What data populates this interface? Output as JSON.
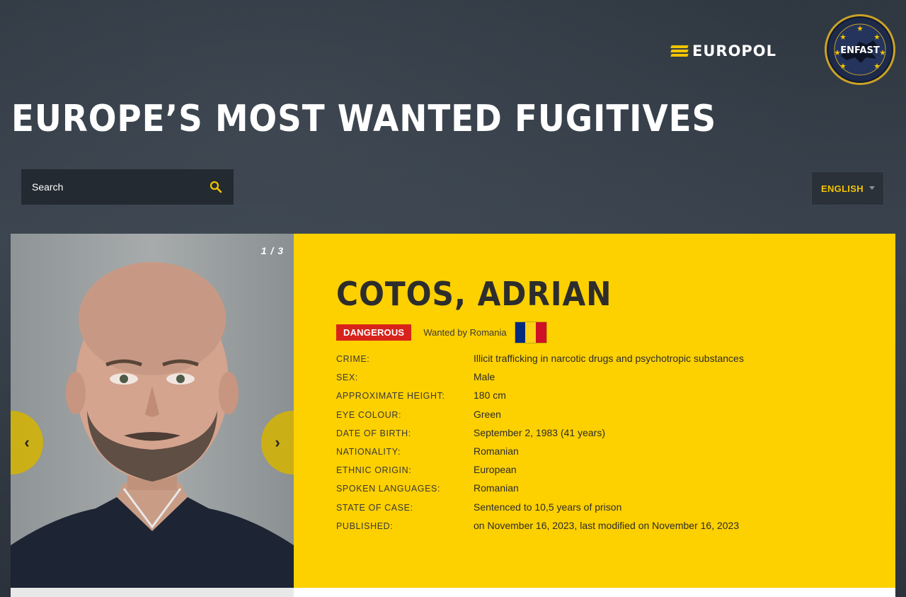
{
  "header": {
    "europol_logo_text": "EUROPOL",
    "enfast_badge_text": "ENFAST",
    "title": "EUROPE’S MOST WANTED FUGITIVES"
  },
  "search": {
    "placeholder": "Search"
  },
  "language": {
    "selected": "ENGLISH"
  },
  "gallery": {
    "counter": "1 / 3",
    "prev_label": "‹",
    "next_label": "›"
  },
  "fugitive": {
    "name": "COTOS, ADRIAN",
    "danger_label": "DANGEROUS",
    "wanted_by": "Wanted by Romania",
    "flag_colors": [
      "#002B7F",
      "#FCD116",
      "#CE1126"
    ],
    "details": [
      {
        "label": "CRIME:",
        "value": "Illicit trafficking in narcotic drugs and psychotropic substances"
      },
      {
        "label": "SEX:",
        "value": "Male"
      },
      {
        "label": "APPROXIMATE HEIGHT:",
        "value": "180 cm"
      },
      {
        "label": "EYE COLOUR:",
        "value": "Green"
      },
      {
        "label": "DATE OF BIRTH:",
        "value": "September 2, 1983 (41 years)"
      },
      {
        "label": "NATIONALITY:",
        "value": "Romanian"
      },
      {
        "label": "ETHNIC ORIGIN:",
        "value": "European"
      },
      {
        "label": "SPOKEN LANGUAGES:",
        "value": "Romanian"
      },
      {
        "label": "STATE OF CASE:",
        "value": "Sentenced to 10,5 years of prison"
      },
      {
        "label": "PUBLISHED:",
        "value": "on November 16, 2023, last modified on November 16, 2023"
      }
    ]
  },
  "colors": {
    "accent": "#FDD000",
    "danger": "#D8231B",
    "background": "#2E3640"
  }
}
